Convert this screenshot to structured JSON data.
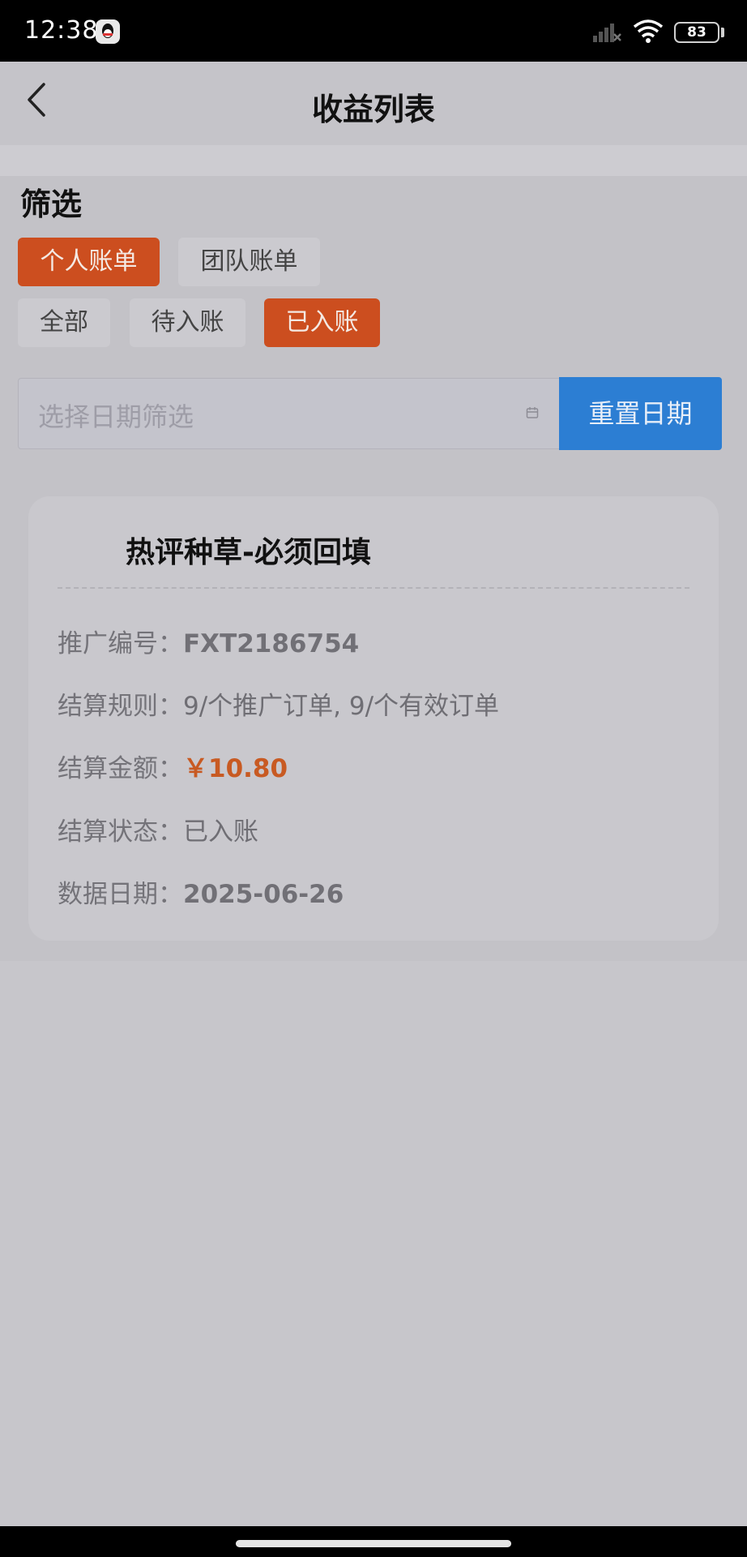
{
  "status_bar": {
    "time": "12:38",
    "battery": "83",
    "icons": [
      "qq-icon",
      "signal-icon",
      "wifi-icon",
      "battery-icon"
    ]
  },
  "header": {
    "title": "收益列表",
    "back_icon": "chevron-left-icon"
  },
  "filter": {
    "title": "筛选",
    "bill_types": [
      "个人账单",
      "团队账单"
    ],
    "bill_type_selected": "个人账单",
    "statuses": [
      "全部",
      "待入账",
      "已入账"
    ],
    "status_selected": "已入账",
    "date_placeholder": "选择日期筛选",
    "reset_label": "重置日期"
  },
  "colors": {
    "accent_orange": "#cc4e1f",
    "button_blue": "#2c7ed3",
    "amount_orange": "#c85a22"
  },
  "card": {
    "title": "热评种草-必须回填",
    "promo_label": "推广编号：",
    "promo_value": "FXT2186754",
    "rule_label": "结算规则：",
    "rule_value": "9/个推广订单, 9/个有效订单",
    "amount_label": "结算金额：",
    "amount_value": "￥10.80",
    "status_label": "结算状态：",
    "status_value": "已入账",
    "date_label": "数据日期：",
    "date_value": "2025-06-26"
  }
}
